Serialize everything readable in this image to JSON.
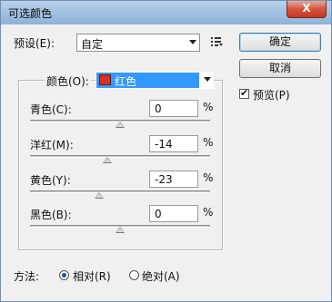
{
  "window": {
    "title": "可选颜色",
    "close_glyph": "X"
  },
  "preset": {
    "label": "预设(E):",
    "value": "自定"
  },
  "buttons": {
    "ok": "确定",
    "cancel": "取消"
  },
  "preview": {
    "label": "预览(P)",
    "checked": true
  },
  "colors": {
    "label": "颜色(O):",
    "value": "红色",
    "swatch_color": "#d8321e"
  },
  "sliders": [
    {
      "label": "青色(C):",
      "value": "0",
      "unit": "%",
      "amount_percent": 0
    },
    {
      "label": "洋红(M):",
      "value": "-14",
      "unit": "%",
      "amount_percent": -14
    },
    {
      "label": "黄色(Y):",
      "value": "-23",
      "unit": "%",
      "amount_percent": -23
    },
    {
      "label": "黑色(B):",
      "value": "0",
      "unit": "%",
      "amount_percent": 0
    }
  ],
  "method": {
    "label": "方法:",
    "options": [
      {
        "label": "相对(R)",
        "selected": true
      },
      {
        "label": "绝对(A)",
        "selected": false
      }
    ]
  }
}
